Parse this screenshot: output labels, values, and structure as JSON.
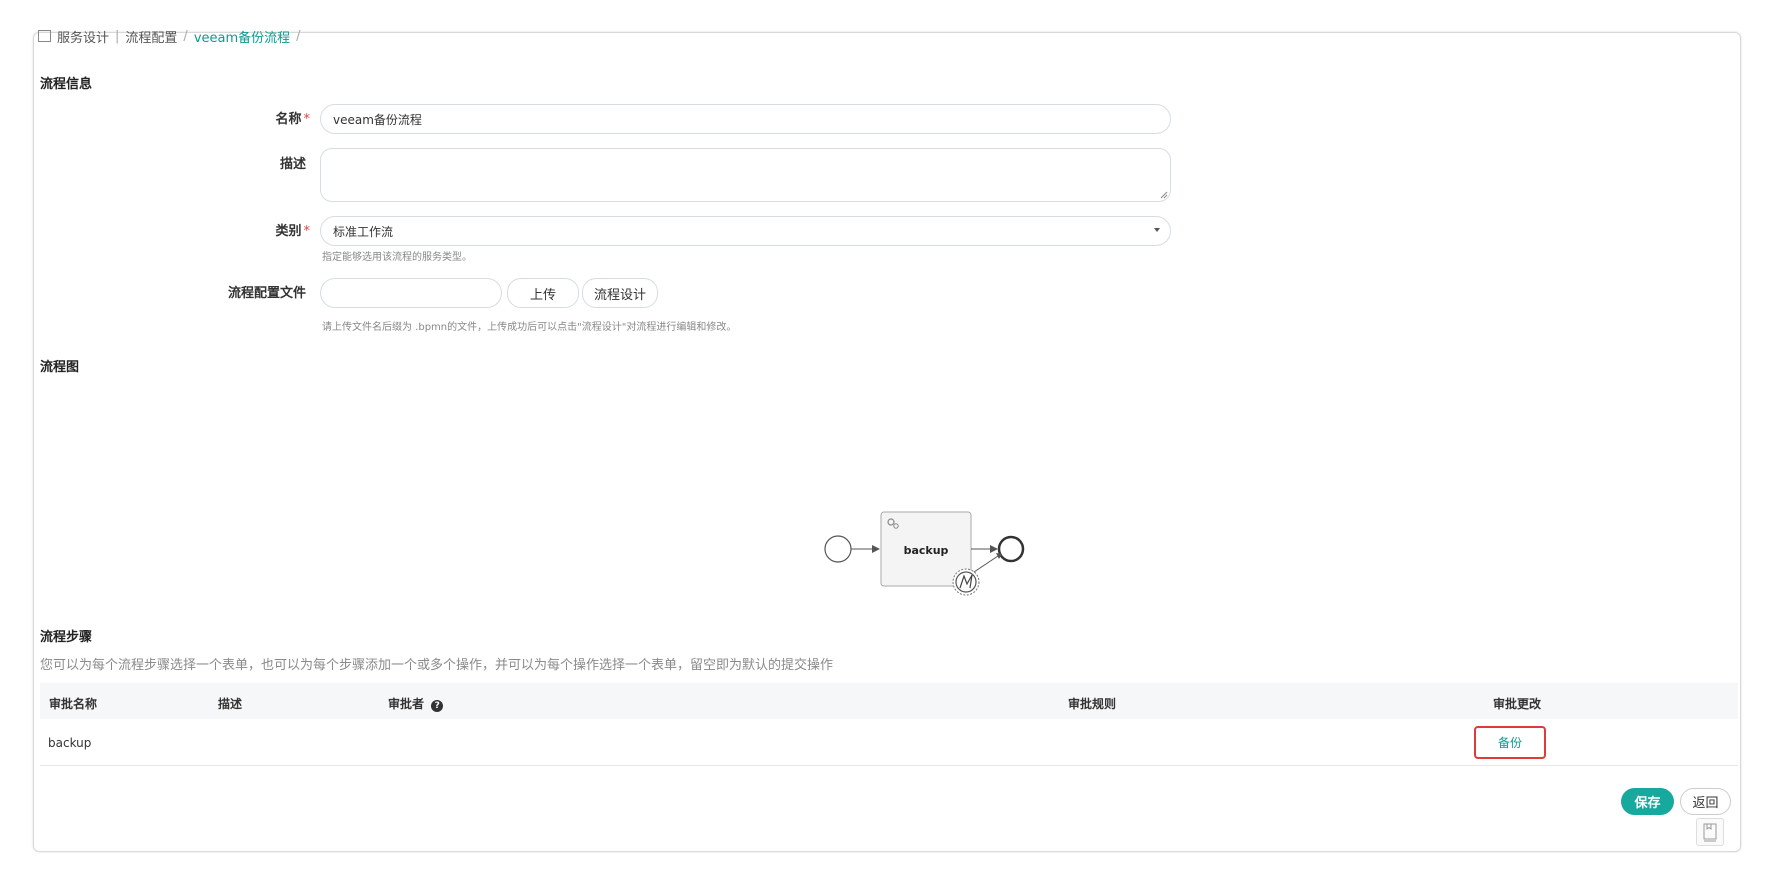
{
  "breadcrumb": {
    "items": [
      "服务设计",
      "流程配置",
      "veeam备份流程"
    ],
    "trailing_sep": "/"
  },
  "process_info": {
    "title": "流程信息",
    "name_label": "名称",
    "name_value": "veeam备份流程",
    "desc_label": "描述",
    "desc_value": "",
    "category_label": "类别",
    "category_value": "标准工作流",
    "category_hint": "指定能够选用该流程的服务类型。",
    "config_label": "流程配置文件",
    "config_value": "",
    "upload_button": "上传",
    "design_button": "流程设计",
    "config_hint": "请上传文件名后缀为 .bpmn的文件，上传成功后可以点击\"流程设计\"对流程进行编辑和修改。",
    "required_mark": "*"
  },
  "diagram": {
    "title": "流程图",
    "task_label": "backup"
  },
  "steps": {
    "title": "流程步骤",
    "description": "您可以为每个流程步骤选择一个表单，也可以为每个步骤添加一个或多个操作，并可以为每个操作选择一个表单，留空即为默认的提交操作",
    "columns": [
      "审批名称",
      "描述",
      "审批者",
      "审批规则",
      "审批更改"
    ],
    "rows": [
      {
        "name": "backup",
        "desc": "",
        "approver": "",
        "rule": "",
        "change": "备份"
      }
    ]
  },
  "actions": {
    "save": "保存",
    "back": "返回"
  },
  "colors": {
    "accent": "#17a99d",
    "highlight_border": "#e13a3a"
  }
}
